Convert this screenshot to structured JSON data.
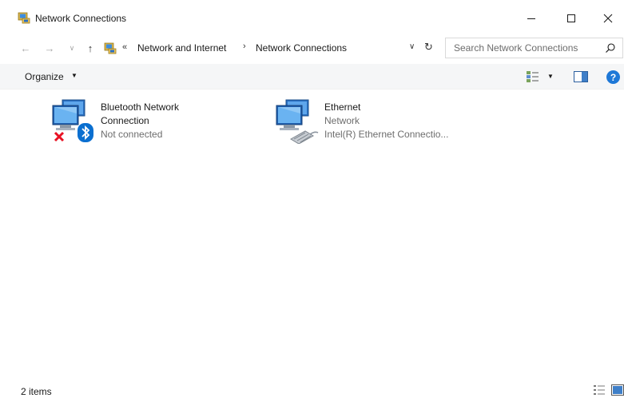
{
  "window": {
    "title": "Network Connections",
    "icon": "network-connections-folder-icon",
    "controls": [
      "minimize-icon",
      "maximize-icon",
      "close-icon"
    ]
  },
  "navigation": {
    "back": "←",
    "forward": "→",
    "recent": "∨",
    "up": "↑"
  },
  "address": {
    "overflow": "«",
    "breadcrumbs": [
      "Network and Internet",
      "Network Connections"
    ],
    "separator": "›",
    "dropdown": "∨",
    "refresh": "↻"
  },
  "search": {
    "placeholder": "Search Network Connections",
    "value": ""
  },
  "toolbar": {
    "organize_label": "Organize",
    "organize_caret": "▼",
    "view_caret": "▼",
    "help_label": "?"
  },
  "connections": [
    {
      "name": "Bluetooth Network Connection",
      "status": "Not connected",
      "device": "",
      "icon": "bluetooth-network-adapter-icon",
      "badges": [
        "disconnected-x-icon",
        "bluetooth-icon"
      ]
    },
    {
      "name": "Ethernet",
      "status": "Network",
      "device": "Intel(R) Ethernet Connectio...",
      "icon": "ethernet-network-adapter-icon",
      "badges": [
        "network-cable-icon"
      ]
    }
  ],
  "status_bar": {
    "item_count": "2 items"
  },
  "colors": {
    "accent": "#1e78d7",
    "error": "#e81123",
    "bluetooth": "#0a6fd0"
  }
}
